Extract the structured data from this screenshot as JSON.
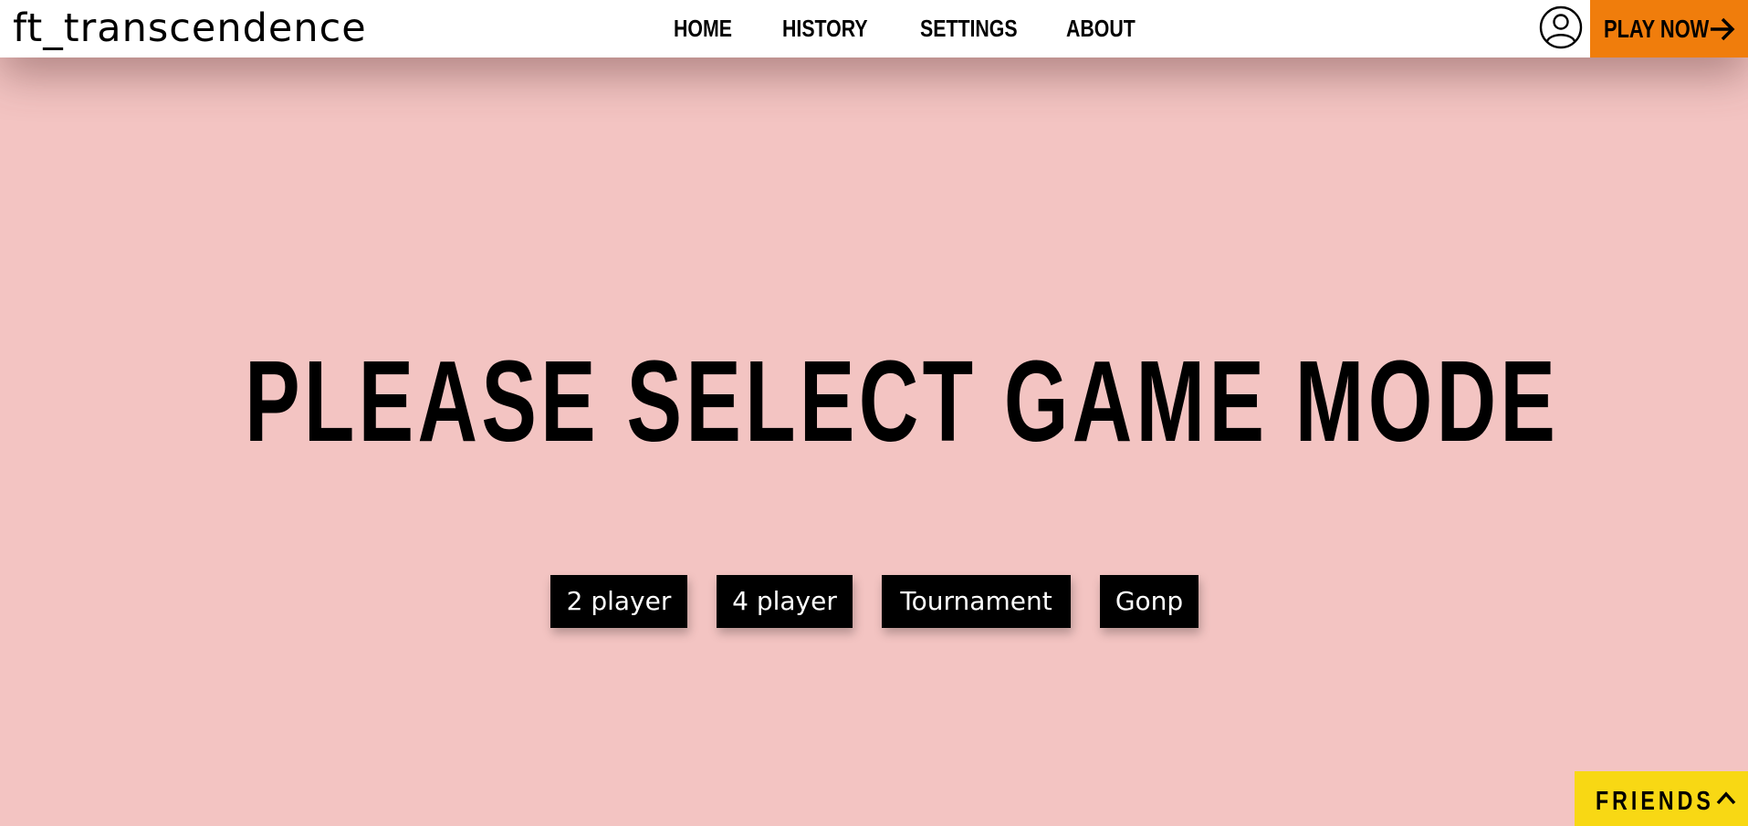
{
  "header": {
    "brand": "ft_transcendence",
    "nav": [
      {
        "label": "HOME"
      },
      {
        "label": "HISTORY"
      },
      {
        "label": "SETTINGS"
      },
      {
        "label": "ABOUT"
      }
    ],
    "profile_icon": "user-circle-icon",
    "play_now_label": "PLAY NOW",
    "play_now_icon": "arrow-right-icon",
    "play_now_color": "#f07d0c"
  },
  "main": {
    "headline": "PLEASE SELECT GAME MODE",
    "modes": [
      {
        "label": "2 player"
      },
      {
        "label": "4 player"
      },
      {
        "label": "Tournament"
      },
      {
        "label": "Gonp"
      }
    ],
    "background_color": "#f3c4c2"
  },
  "friends": {
    "label": "FRIENDS",
    "icon": "chevron-up-icon",
    "color": "#f8d814"
  }
}
